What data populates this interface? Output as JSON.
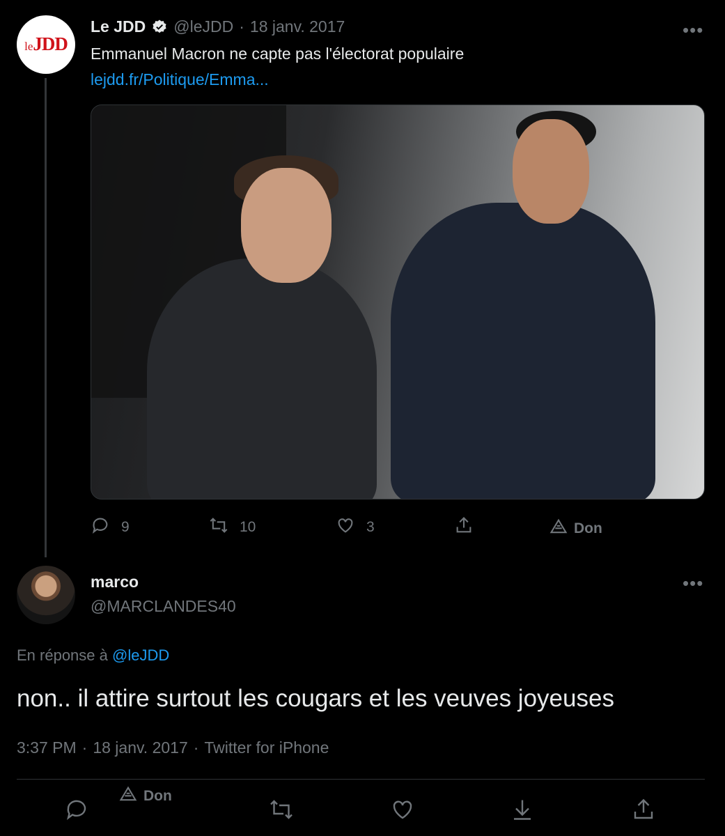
{
  "original_tweet": {
    "display_name": "Le JDD",
    "verified": true,
    "handle": "@leJDD",
    "separator": "·",
    "date": "18 janv. 2017",
    "avatar_logo_prefix": "le",
    "avatar_logo_main": "JDD",
    "text": "Emmanuel Macron ne capte pas l'électorat populaire",
    "link": "lejdd.fr/Politique/Emma...",
    "more_label": "•••",
    "actions": {
      "replies": "9",
      "retweets": "10",
      "likes": "3",
      "donate_label": "Don"
    }
  },
  "reply_tweet": {
    "display_name": "marco",
    "handle": "@MARCLANDES40",
    "more_label": "•••",
    "in_reply_prefix": "En réponse à",
    "in_reply_handle": "@leJDD",
    "text": "non.. il attire surtout les cougars et les veuves joyeuses",
    "time": "3:37 PM",
    "date": "18 janv. 2017",
    "source": "Twitter for iPhone",
    "donate_label": "Don"
  },
  "colors": {
    "background": "#000000",
    "text": "#e7e9ea",
    "muted": "#71767b",
    "link": "#1d9bf0",
    "logo_red": "#d0121a"
  }
}
